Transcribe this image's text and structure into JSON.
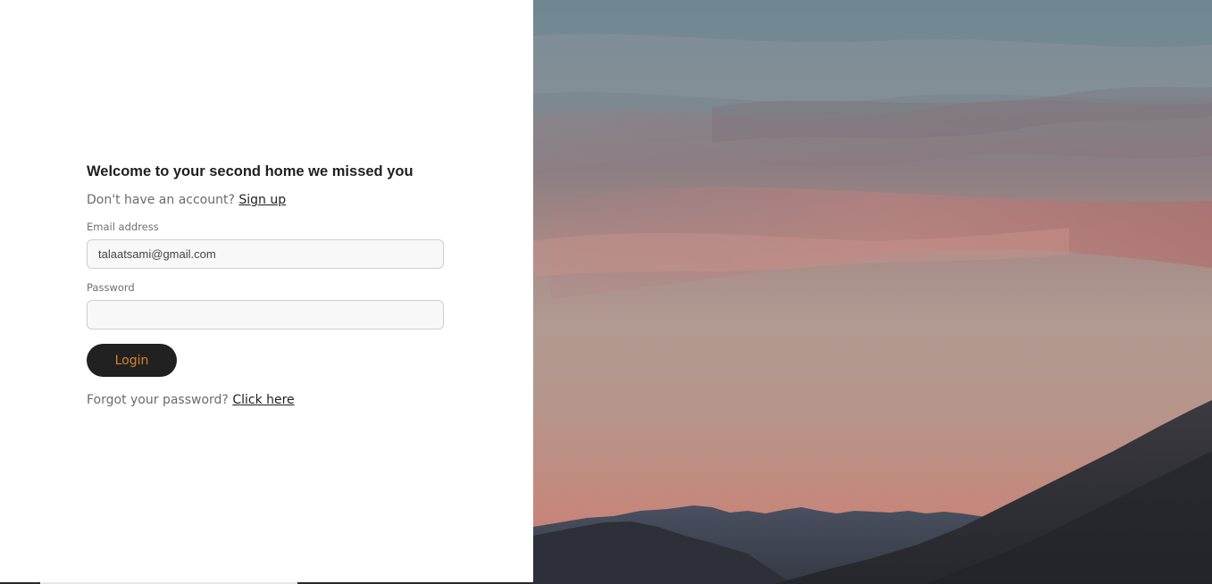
{
  "login": {
    "heading": "Welcome to your second home we missed you",
    "signup_prompt": "Don't have an account?",
    "signup_link": "Sign up",
    "email_label": "Email address",
    "email_value": "talaatsami@gmail.com",
    "password_label": "Password",
    "password_value": "",
    "login_button": "Login",
    "forgot_prompt": "Forgot your password?",
    "forgot_link": "Click here"
  },
  "colors": {
    "button_bg": "#212121",
    "button_text": "#d9822b",
    "heading": "#1f1f1f"
  },
  "hero_image": {
    "icon": "sunset-mountain-landscape"
  }
}
